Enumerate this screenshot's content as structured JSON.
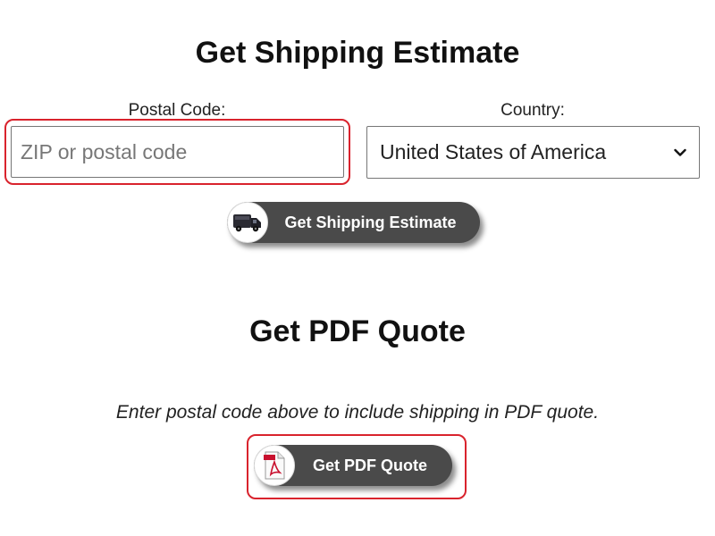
{
  "shipping_section": {
    "heading": "Get Shipping Estimate",
    "postal_label": "Postal Code:",
    "postal_placeholder": "ZIP or postal code",
    "postal_value": "",
    "country_label": "Country:",
    "country_selected": "United States of America",
    "button_label": "Get Shipping Estimate",
    "button_icon": "truck-icon"
  },
  "pdf_section": {
    "heading": "Get PDF Quote",
    "note": "Enter postal code above to include shipping in PDF quote.",
    "button_label": "Get PDF Quote",
    "button_icon": "pdf-file-icon"
  },
  "colors": {
    "highlight": "#d9232d",
    "button_bg": "#4a4a4a",
    "pdf_accent": "#c8102e"
  }
}
